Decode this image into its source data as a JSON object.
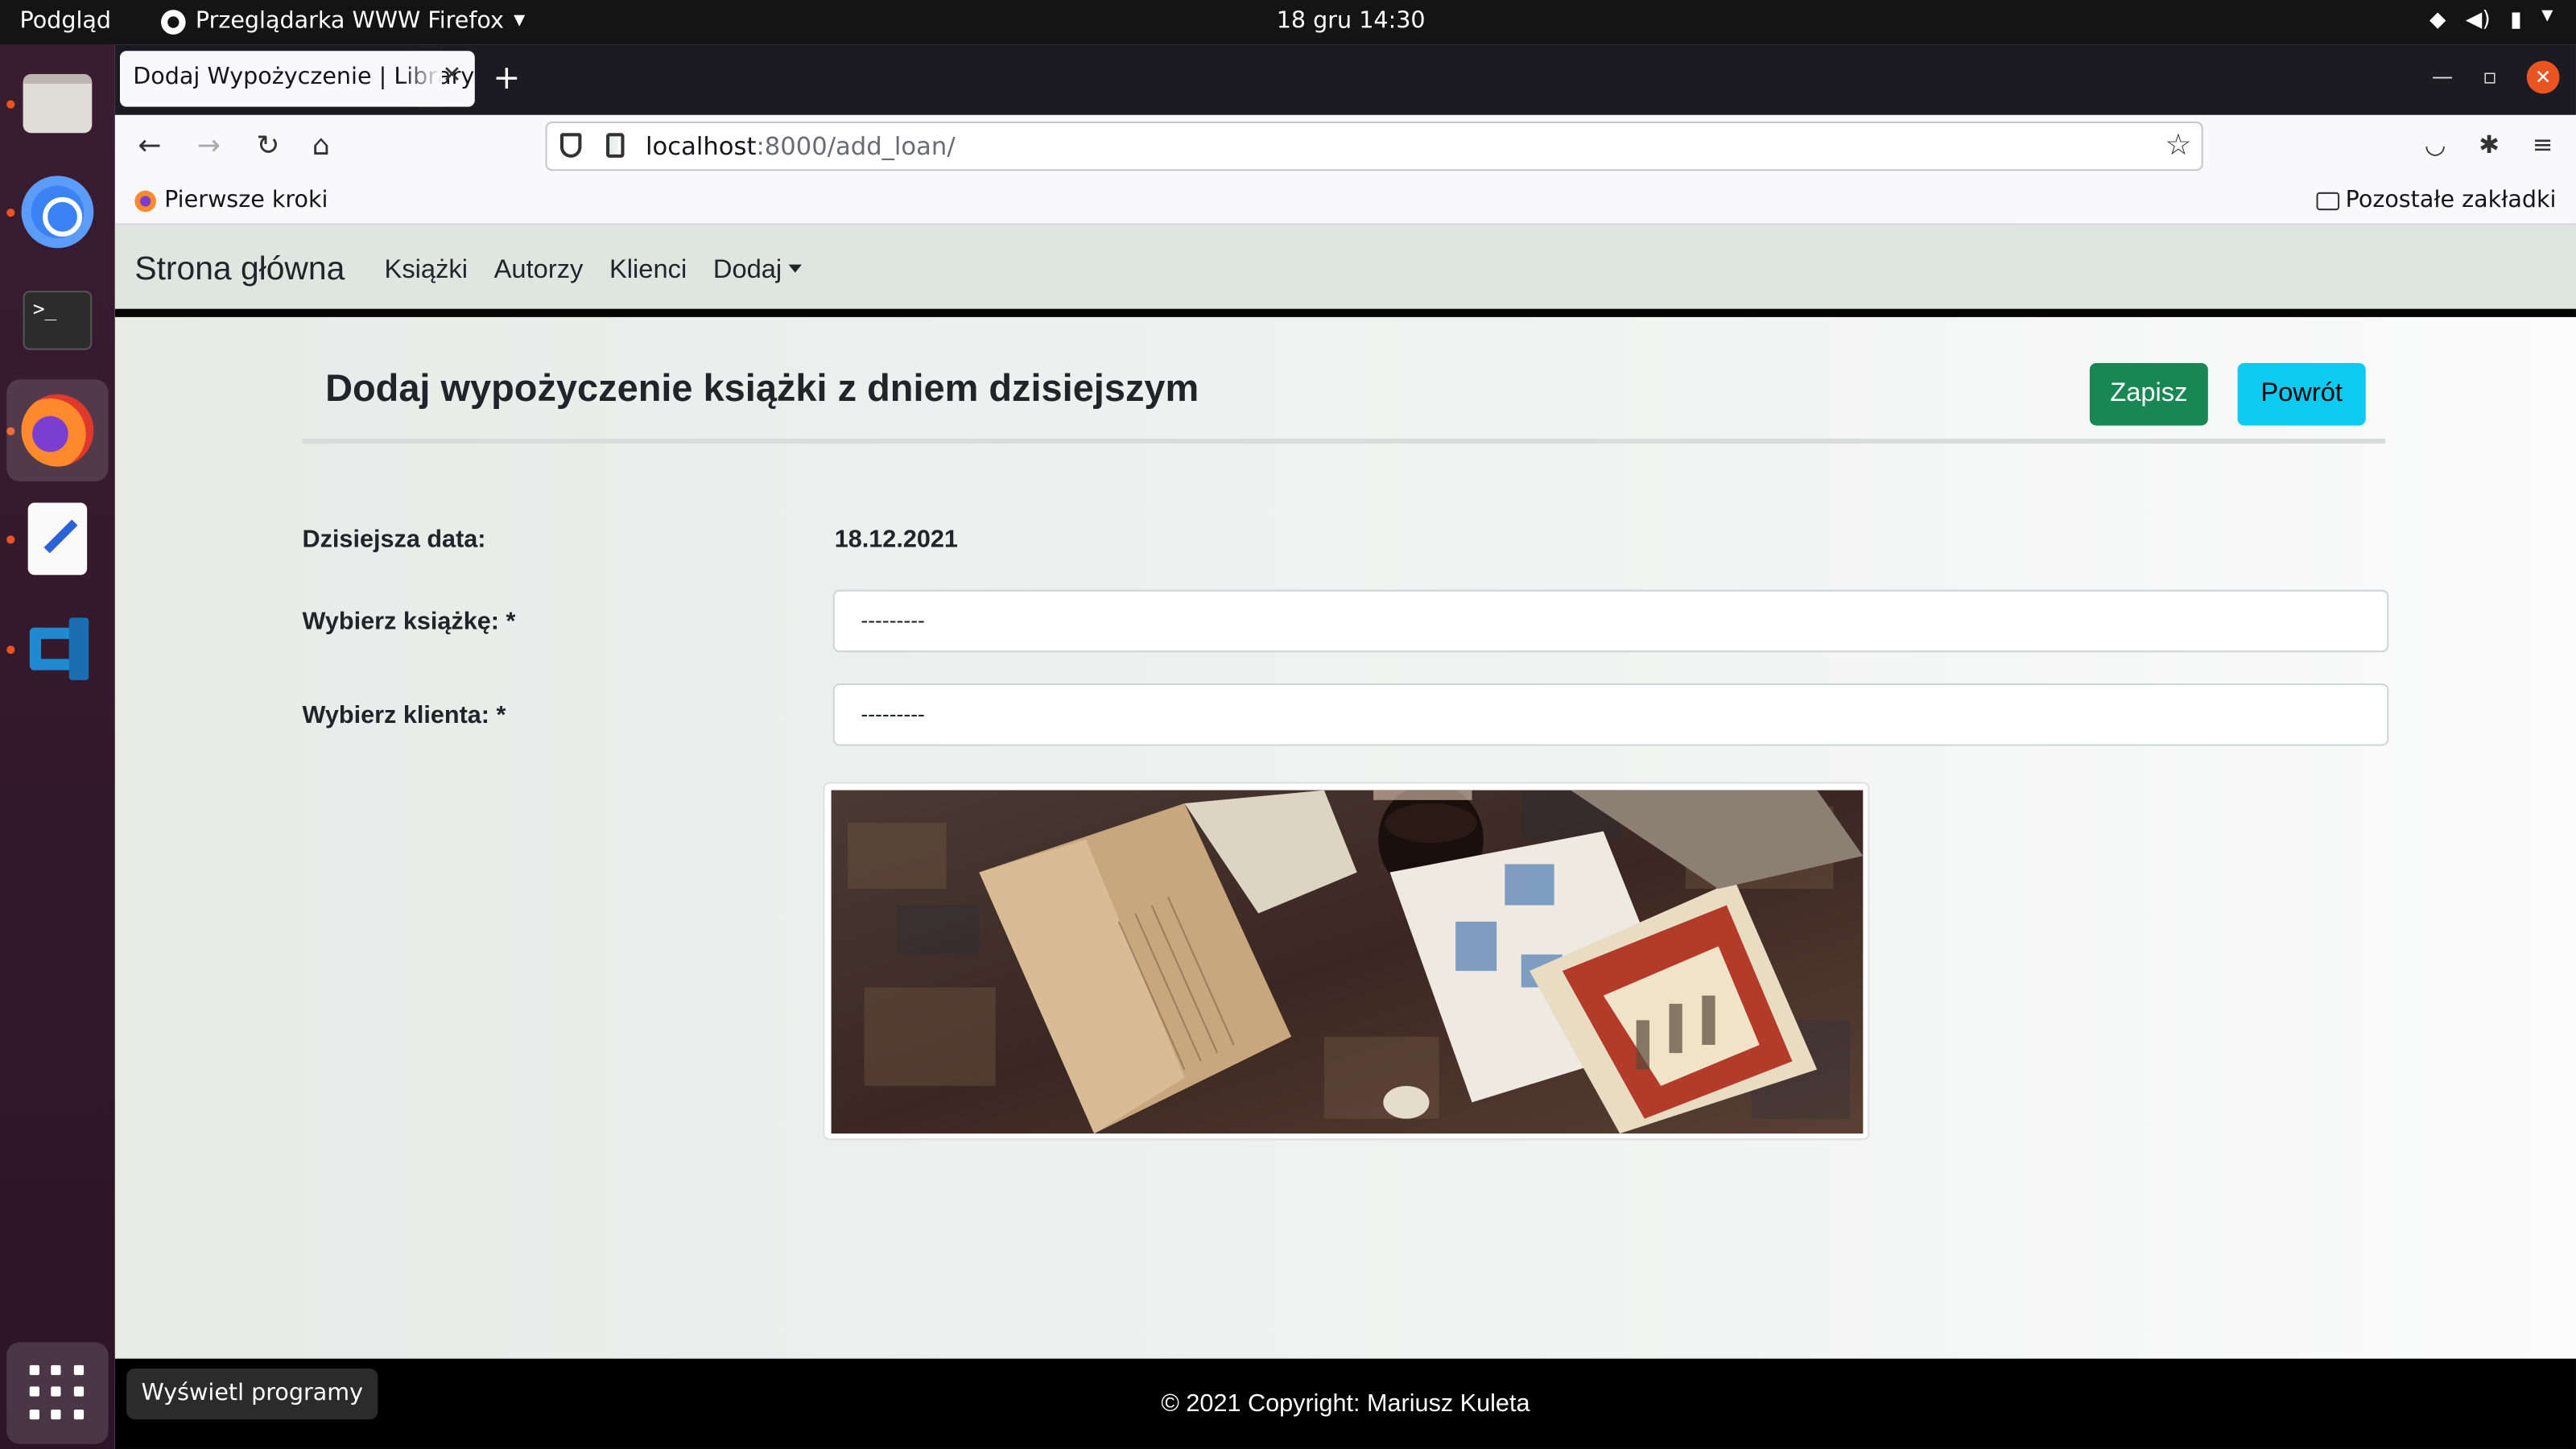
{
  "os": {
    "activities": "Podgląd",
    "app_menu": "Przeglądarka WWW Firefox",
    "clock": "18 gru  14:30",
    "tooltip": "Wyświetl programy"
  },
  "browser": {
    "tab_title": "Dodaj Wypożyczenie | Library",
    "url_host": "localhost",
    "url_path": ":8000/add_loan/",
    "bookmark_1": "Pierwsze kroki",
    "bookmark_other": "Pozostałe zakładki"
  },
  "site": {
    "brand": "Strona główna",
    "nav": [
      "Książki",
      "Autorzy",
      "Klienci",
      "Dodaj"
    ],
    "page_title": "Dodaj wypożyczenie książki z dniem dzisiejszym",
    "save_label": "Zapisz",
    "back_label": "Powrót",
    "form": {
      "date_label": "Dzisiejsza data:",
      "date_value": "18.12.2021",
      "book_label": "Wybierz książkę: *",
      "book_value": "---------",
      "client_label": "Wybierz klienta: *",
      "client_value": "---------"
    },
    "footer": "© 2021 Copyright: Mariusz Kuleta"
  },
  "colors": {
    "save": "#198754",
    "back": "#0dcaf0",
    "accent": "#e95420"
  }
}
